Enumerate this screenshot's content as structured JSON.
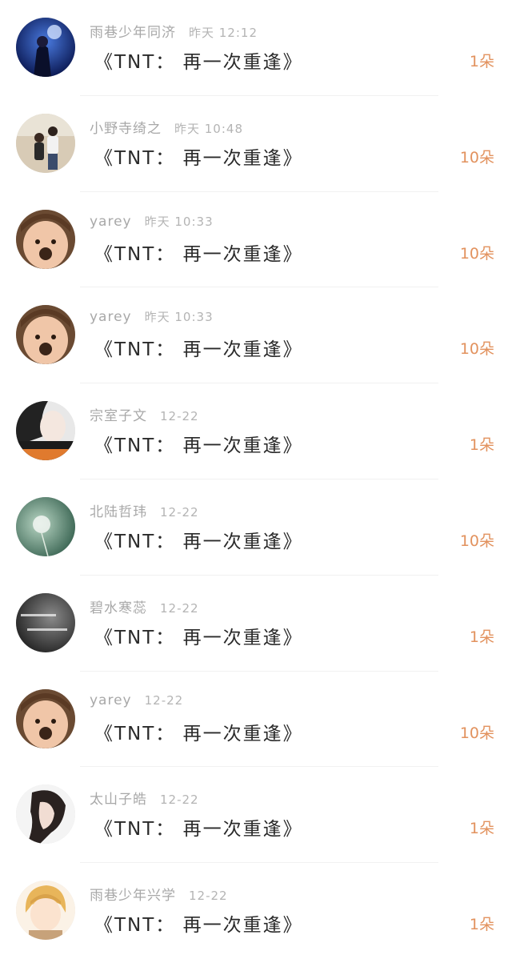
{
  "gifts": [
    {
      "user": "雨巷少年同济",
      "time": "昨天 12:12",
      "title": "《TNT： 再一次重逢》",
      "count": "1朵",
      "avatar": "avatar-night-sky"
    },
    {
      "user": "小野寺绮之",
      "time": "昨天 10:48",
      "title": "《TNT： 再一次重逢》",
      "count": "10朵",
      "avatar": "avatar-couple-photo"
    },
    {
      "user": "yarey",
      "time": "昨天 10:33",
      "title": "《TNT： 再一次重逢》",
      "count": "10朵",
      "avatar": "avatar-child-face"
    },
    {
      "user": "yarey",
      "time": "昨天 10:33",
      "title": "《TNT： 再一次重逢》",
      "count": "10朵",
      "avatar": "avatar-child-face"
    },
    {
      "user": "宗室子文",
      "time": "12-22",
      "title": "《TNT： 再一次重逢》",
      "count": "1朵",
      "avatar": "avatar-girl-text"
    },
    {
      "user": "北陆哲玮",
      "time": "12-22",
      "title": "《TNT： 再一次重逢》",
      "count": "10朵",
      "avatar": "avatar-dandelion"
    },
    {
      "user": "碧水寒蕊",
      "time": "12-22",
      "title": "《TNT： 再一次重逢》",
      "count": "1朵",
      "avatar": "avatar-dark-text"
    },
    {
      "user": "yarey",
      "time": "12-22",
      "title": "《TNT： 再一次重逢》",
      "count": "10朵",
      "avatar": "avatar-child-face"
    },
    {
      "user": "太山子皓",
      "time": "12-22",
      "title": "《TNT： 再一次重逢》",
      "count": "1朵",
      "avatar": "avatar-woman-profile"
    },
    {
      "user": "雨巷少年兴学",
      "time": "12-22",
      "title": "《TNT： 再一次重逢》",
      "count": "1朵",
      "avatar": "avatar-anime-boy"
    }
  ],
  "colors": {
    "count": "#e2925e",
    "meta": "#a8a8a8",
    "title": "#2a2a2a",
    "divider": "#f1f1f1"
  }
}
